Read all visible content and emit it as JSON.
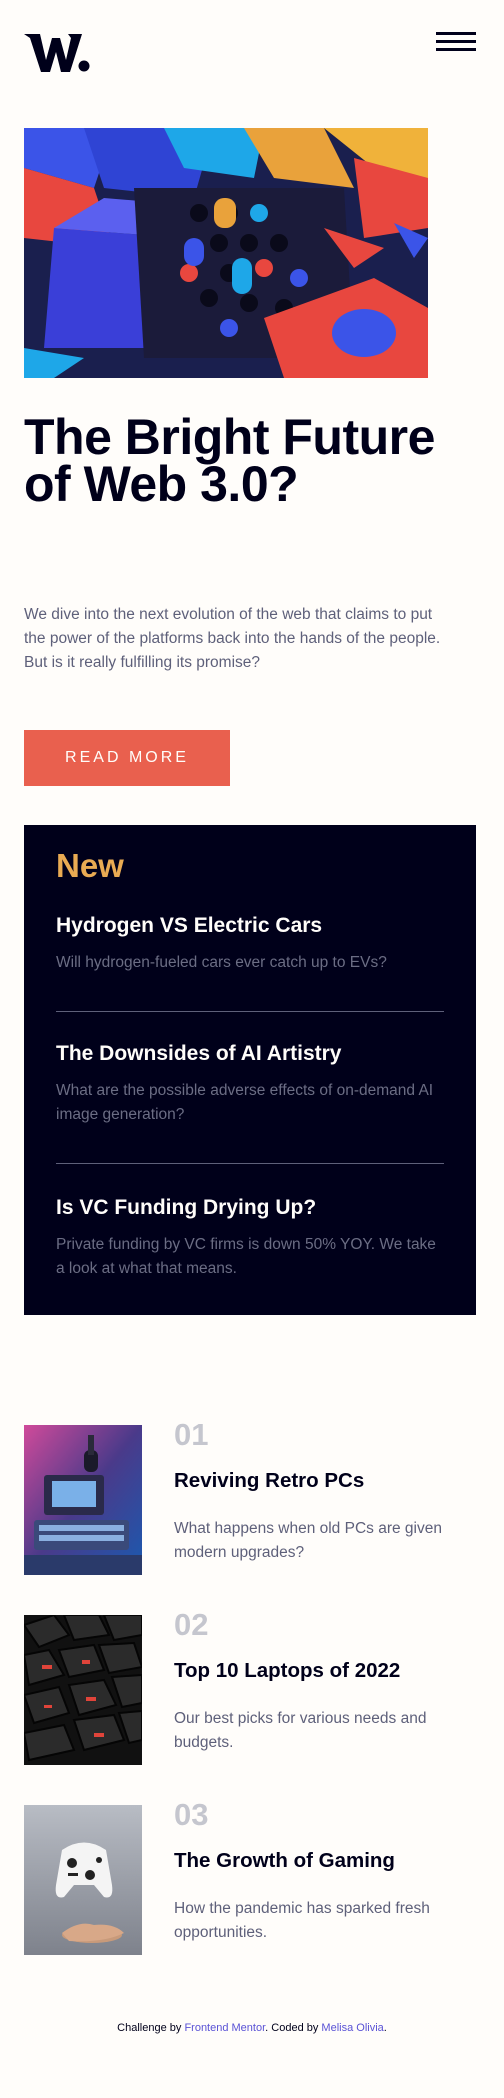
{
  "header": {
    "logo_alt": "W.",
    "menu_icon": "hamburger-menu-icon"
  },
  "hero": {
    "image_icon": "colorful-3d-blocks-image",
    "title": "The Bright Future of Web 3.0?",
    "description": "We dive into the next evolution of the web that claims to put the power of the platforms back into the hands of the people. But is it really fulfilling its promise?",
    "button_label": "READ MORE"
  },
  "new_panel": {
    "heading": "New",
    "items": [
      {
        "title": "Hydrogen VS Electric Cars",
        "description": "Will hydrogen-fueled cars ever catch up to EVs?"
      },
      {
        "title": "The Downsides of AI Artistry",
        "description": "What are the possible adverse effects of on-demand AI image generation?"
      },
      {
        "title": "Is VC Funding Drying Up?",
        "description": "Private funding by VC firms is down 50% YOY. We take a look at what that means."
      }
    ]
  },
  "articles": [
    {
      "number": "01",
      "title": "Reviving Retro PCs",
      "description": "What happens when old PCs are given modern upgrades?",
      "image_icon": "retro-pc-image"
    },
    {
      "number": "02",
      "title": "Top 10 Laptops of 2022",
      "description": "Our best picks for various needs and budgets.",
      "image_icon": "laptop-keyboard-image"
    },
    {
      "number": "03",
      "title": "The Growth of Gaming",
      "description": "How the pandemic has sparked fresh opportunities.",
      "image_icon": "game-controller-image"
    }
  ],
  "footer": {
    "prefix": "Challenge by ",
    "link1": "Frontend Mentor",
    "middle": ". Coded by ",
    "link2": "Melisa Olivia",
    "suffix": "."
  },
  "colors": {
    "accent_red": "#e9604e",
    "accent_orange": "#e9ab53",
    "dark_navy": "#00001a",
    "off_white": "#fffdfa",
    "grayish_blue": "#5e607a"
  }
}
